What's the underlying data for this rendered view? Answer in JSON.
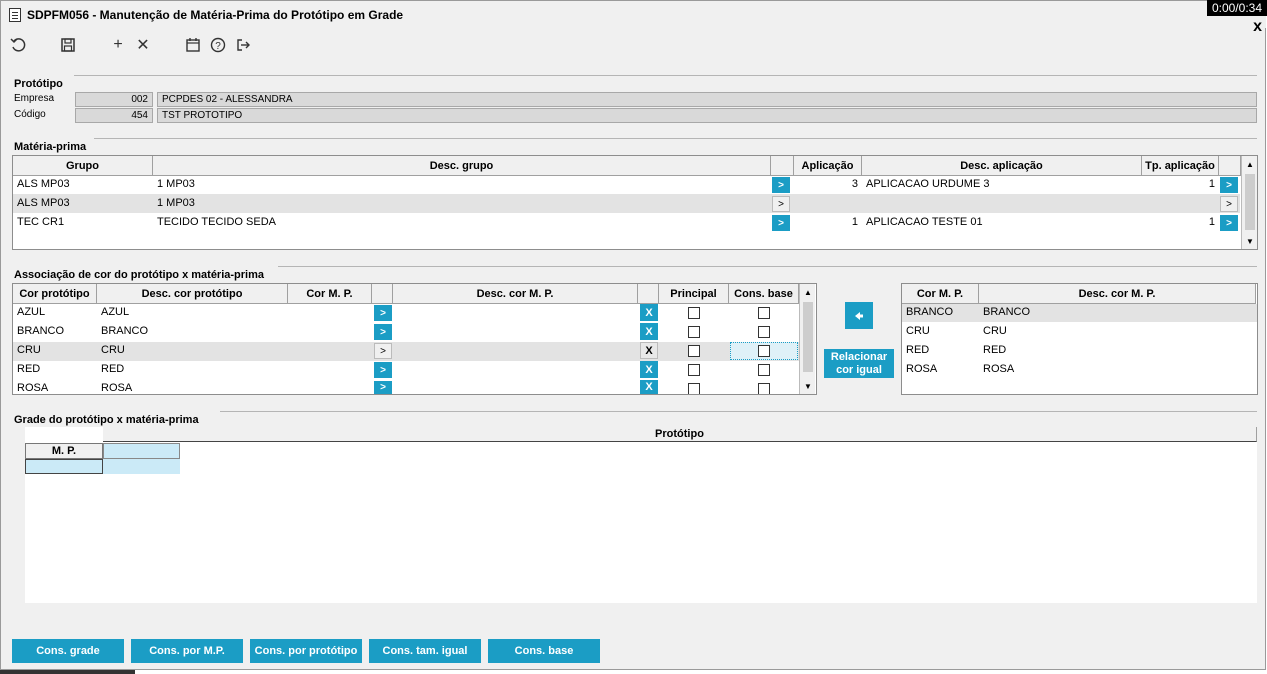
{
  "window": {
    "title": "SDPFM056 - Manutenção de Matéria-Prima do Protótipo em Grade",
    "timer": "0:00/0:34",
    "close": "x"
  },
  "toolbar": {
    "icons": [
      "undo-icon",
      "save-icon",
      "add-icon",
      "delete-icon",
      "calendar-icon",
      "help-icon",
      "exit-icon"
    ],
    "add": "+",
    "delete": "✕"
  },
  "prototipo": {
    "section": "Protótipo",
    "empresa_label": "Empresa",
    "empresa_code": "002",
    "empresa_name": "PCPDES 02 - ALESSANDRA",
    "codigo_label": "Código",
    "codigo_code": "454",
    "codigo_name": "TST PROTOTIPO"
  },
  "materia_prima": {
    "section": "Matéria-prima",
    "headers": {
      "grupo": "Grupo",
      "desc_grupo": "Desc. grupo",
      "aplicacao": "Aplicação",
      "desc_aplicacao": "Desc. aplicação",
      "tp_aplicacao": "Tp. aplicação"
    },
    "rows": [
      {
        "grupo": "ALS MP03",
        "desc": "1 MP03",
        "aplicacao": "3",
        "desc_aplicacao": "APLICACAO URDUME 3",
        "tp": "1"
      },
      {
        "grupo": "ALS MP03",
        "desc": "1 MP03",
        "aplicacao": "",
        "desc_aplicacao": "",
        "tp": ""
      },
      {
        "grupo": "TEC CR1",
        "desc": "TECIDO TECIDO SEDA",
        "aplicacao": "1",
        "desc_aplicacao": "APLICACAO TESTE 01",
        "tp": "1"
      }
    ]
  },
  "associacao": {
    "section": "Associação de cor do protótipo x matéria-prima",
    "headers": {
      "cor_prototipo": "Cor protótipo",
      "desc_cor_prototipo": "Desc. cor protótipo",
      "cor_mp": "Cor M. P.",
      "desc_cor_mp": "Desc. cor M. P.",
      "principal": "Principal",
      "cons_base": "Cons. base"
    },
    "rows": [
      {
        "cor": "AZUL",
        "desc": "AZUL"
      },
      {
        "cor": "BRANCO",
        "desc": "BRANCO"
      },
      {
        "cor": "CRU",
        "desc": "CRU"
      },
      {
        "cor": "RED",
        "desc": "RED"
      },
      {
        "cor": "ROSA",
        "desc": "ROSA"
      }
    ],
    "btn_arrow": ">",
    "btn_x": "X",
    "relacionar": "Relacionar cor igual",
    "right_headers": {
      "cor_mp": "Cor M. P.",
      "desc_cor_mp": "Desc. cor M. P."
    },
    "right_rows": [
      {
        "cor": "BRANCO",
        "desc": "BRANCO"
      },
      {
        "cor": "CRU",
        "desc": "CRU"
      },
      {
        "cor": "RED",
        "desc": "RED"
      },
      {
        "cor": "ROSA",
        "desc": "ROSA"
      }
    ]
  },
  "grade": {
    "section": "Grade do protótipo x matéria-prima",
    "prototipo_header": "Protótipo",
    "mp_header": "M. P."
  },
  "buttons": {
    "cons_grade": "Cons. grade",
    "cons_por_mp": "Cons. por M.P.",
    "cons_por_prototipo": "Cons. por protótipo",
    "cons_tam_igual": "Cons. tam. igual",
    "cons_base": "Cons. base"
  },
  "colors": {
    "accent": "#1b9dc5",
    "window_bg": "#f0f0f0"
  }
}
